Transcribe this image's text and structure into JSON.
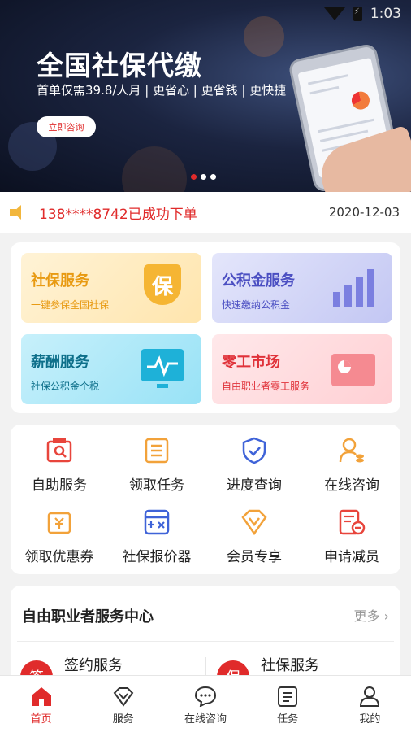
{
  "status_bar": {
    "time": "1:03"
  },
  "banner": {
    "title": "全国社保代缴",
    "subtitle": "首单仅需39.8/人月 | 更省心 | 更省钱 | 更快捷",
    "button_label": "立即咨询",
    "slides": 3,
    "active_slide": 1
  },
  "notice": {
    "text": "138****8742已成功下单",
    "date": "2020-12-03"
  },
  "service_cards": [
    {
      "title": "社保服务",
      "desc": "一键参保全国社保",
      "icon": "shield-bao-icon",
      "icon_text": "保"
    },
    {
      "title": "公积金服务",
      "desc": "快速缴纳公积金",
      "icon": "growth-chart-icon"
    },
    {
      "title": "薪酬服务",
      "desc": "社保公积金个税",
      "icon": "monitor-wave-icon"
    },
    {
      "title": "零工市场",
      "desc": "自由职业者零工服务",
      "icon": "folder-chart-icon"
    }
  ],
  "grid": [
    {
      "label": "自助服务",
      "icon": "self-service-icon"
    },
    {
      "label": "领取任务",
      "icon": "task-list-icon"
    },
    {
      "label": "进度查询",
      "icon": "progress-shield-icon"
    },
    {
      "label": "在线咨询",
      "icon": "consult-person-icon"
    },
    {
      "label": "领取优惠券",
      "icon": "coupon-icon"
    },
    {
      "label": "社保报价器",
      "icon": "calculator-icon"
    },
    {
      "label": "会员专享",
      "icon": "diamond-vip-icon"
    },
    {
      "label": "申请减员",
      "icon": "reduce-staff-icon"
    }
  ],
  "center": {
    "title": "自由职业者服务中心",
    "more": "更多",
    "items": [
      {
        "name": "签约服务",
        "icon_text": "签"
      },
      {
        "name": "社保服务",
        "icon_text": "保"
      }
    ]
  },
  "tabbar": [
    {
      "label": "首页",
      "icon": "home-icon",
      "active": true
    },
    {
      "label": "服务",
      "icon": "diamond-service-icon",
      "active": false
    },
    {
      "label": "在线咨询",
      "icon": "chat-bubble-icon",
      "active": false
    },
    {
      "label": "任务",
      "icon": "task-icon",
      "active": false
    },
    {
      "label": "我的",
      "icon": "user-icon",
      "active": false
    }
  ],
  "colors": {
    "brand_red": "#e02b2b",
    "notice_speaker": "#f2b63c",
    "icon_red": "#e8453c",
    "icon_orange": "#f2a23a",
    "icon_blue": "#3f63d8"
  }
}
